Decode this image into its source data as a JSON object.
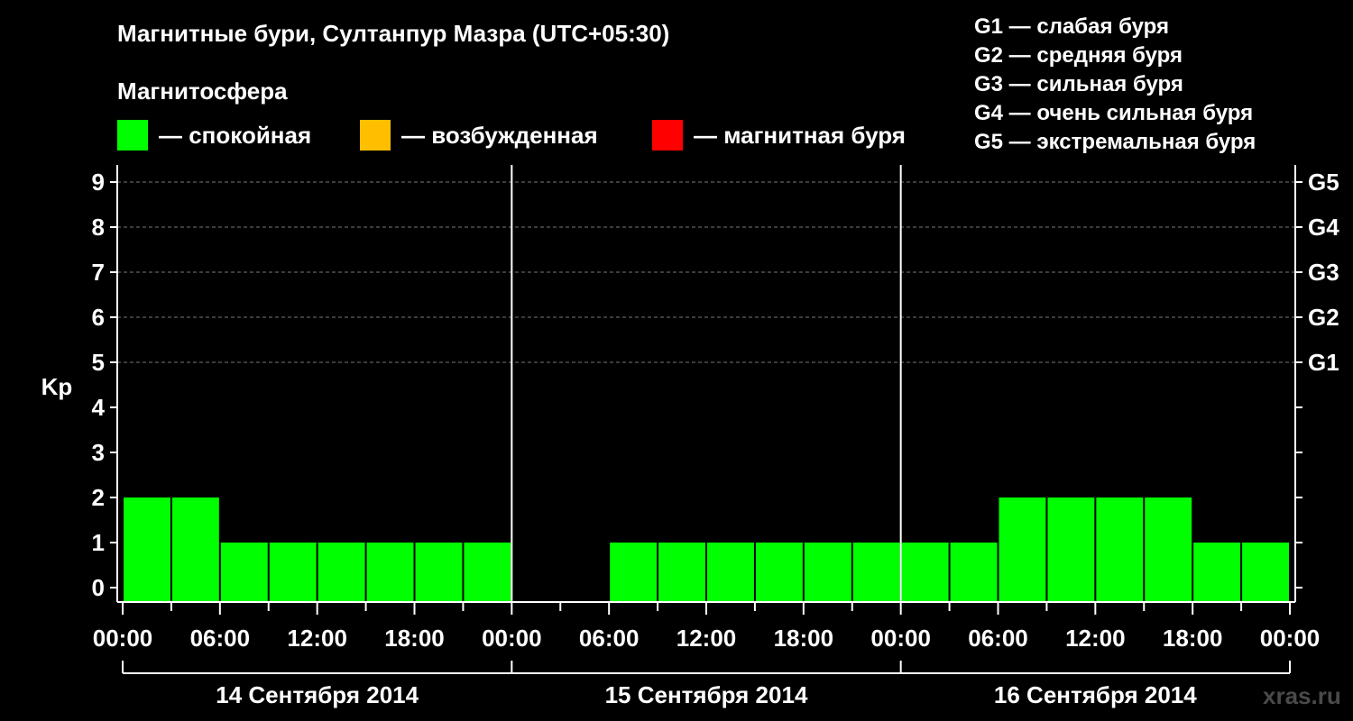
{
  "title": "Магнитные бури, Султанпур Мазра (UTC+05:30)",
  "magnetosphere_label": "Магнитосфера",
  "legend": [
    {
      "label": "— спокойная",
      "color": "#00ff00"
    },
    {
      "label": "— возбужденная",
      "color": "#ffbf00"
    },
    {
      "label": "— магнитная буря",
      "color": "#ff0000"
    }
  ],
  "g_legend": [
    "G1 — слабая буря",
    "G2 — средняя буря",
    "G3 — сильная буря",
    "G4 — очень сильная буря",
    "G5 — экстремальная буря"
  ],
  "watermark": "xras.ru",
  "chart_data": {
    "type": "bar",
    "ylabel": "Kp",
    "ylim": [
      0,
      9
    ],
    "yticks": [
      "0",
      "1",
      "2",
      "3",
      "4",
      "5",
      "6",
      "7",
      "8",
      "9"
    ],
    "right_ticks": [
      {
        "kp": 5,
        "label": "G1"
      },
      {
        "kp": 6,
        "label": "G2"
      },
      {
        "kp": 7,
        "label": "G3"
      },
      {
        "kp": 8,
        "label": "G4"
      },
      {
        "kp": 9,
        "label": "G5"
      }
    ],
    "grid": "dashed horizontal lines at Kp 5–9",
    "xtick_labels": [
      "00:00",
      "06:00",
      "12:00",
      "18:00",
      "00:00",
      "06:00",
      "12:00",
      "18:00",
      "00:00",
      "06:00",
      "12:00",
      "18:00",
      "00:00"
    ],
    "days": [
      "14 Сентября 2014",
      "15 Сентября 2014",
      "16 Сентября 2014"
    ],
    "x_unit": "hours from 14 Sep 2014 00:00",
    "bars": [
      {
        "start": 0,
        "end": 3,
        "kp": 2,
        "level": "спокойная"
      },
      {
        "start": 3,
        "end": 6,
        "kp": 2,
        "level": "спокойная"
      },
      {
        "start": 6,
        "end": 9,
        "kp": 1,
        "level": "спокойная"
      },
      {
        "start": 9,
        "end": 12,
        "kp": 1,
        "level": "спокойная"
      },
      {
        "start": 12,
        "end": 15,
        "kp": 1,
        "level": "спокойная"
      },
      {
        "start": 15,
        "end": 18,
        "kp": 1,
        "level": "спокойная"
      },
      {
        "start": 18,
        "end": 21,
        "kp": 1,
        "level": "спокойная"
      },
      {
        "start": 21,
        "end": 24,
        "kp": 1,
        "level": "спокойная"
      },
      {
        "start": 24,
        "end": 27,
        "kp": 0,
        "level": "спокойная"
      },
      {
        "start": 27,
        "end": 30,
        "kp": 0,
        "level": "спокойная"
      },
      {
        "start": 30,
        "end": 33,
        "kp": 1,
        "level": "спокойная"
      },
      {
        "start": 33,
        "end": 36,
        "kp": 1,
        "level": "спокойная"
      },
      {
        "start": 36,
        "end": 39,
        "kp": 1,
        "level": "спокойная"
      },
      {
        "start": 39,
        "end": 42,
        "kp": 1,
        "level": "спокойная"
      },
      {
        "start": 42,
        "end": 45,
        "kp": 1,
        "level": "спокойная"
      },
      {
        "start": 45,
        "end": 48,
        "kp": 1,
        "level": "спокойная"
      },
      {
        "start": 48,
        "end": 51,
        "kp": 1,
        "level": "спокойная"
      },
      {
        "start": 51,
        "end": 54,
        "kp": 1,
        "level": "спокойная"
      },
      {
        "start": 54,
        "end": 57,
        "kp": 2,
        "level": "спокойная"
      },
      {
        "start": 57,
        "end": 60,
        "kp": 2,
        "level": "спокойная"
      },
      {
        "start": 60,
        "end": 63,
        "kp": 2,
        "level": "спокойная"
      },
      {
        "start": 63,
        "end": 66,
        "kp": 2,
        "level": "спокойная"
      },
      {
        "start": 66,
        "end": 69,
        "kp": 1,
        "level": "спокойная"
      },
      {
        "start": 69,
        "end": 72,
        "kp": 1,
        "level": "спокойная"
      }
    ]
  }
}
